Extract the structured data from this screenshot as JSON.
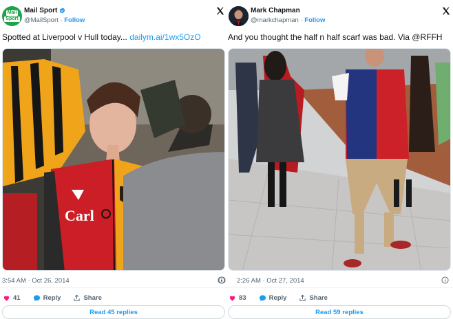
{
  "tweets": [
    {
      "display_name": "Mail Sport",
      "handle": "@MailSport",
      "follow": "Follow",
      "avatar_text": [
        "Mail",
        "Sport"
      ],
      "text": "Spotted at Liverpool v Hull today... ",
      "link": "dailym.ai/1wx5OzO",
      "timestamp": "3:54 AM · Oct 26, 2014",
      "likes": "41",
      "reply_label": "Reply",
      "share_label": "Share",
      "read_replies": "Read 45 replies"
    },
    {
      "display_name": "Mark Chapman",
      "handle": "@markchapman",
      "follow": "Follow",
      "text": "And you thought the half n half scarf was bad. Via @RFFH",
      "timestamp": "2:26 AM · Oct 27, 2014",
      "likes": "83",
      "reply_label": "Reply",
      "share_label": "Share",
      "read_replies": "Read 59 replies"
    }
  ],
  "colors": {
    "link": "#1d9bf0",
    "like": "#f91880",
    "verified": "#1d9bf0",
    "mailsport_green": "#1fa34a"
  },
  "icons": {
    "verified": "verified-badge-icon",
    "x_logo": "x-logo-icon",
    "like": "heart-icon",
    "reply": "reply-bubble-icon",
    "share": "share-icon",
    "info": "info-icon"
  }
}
